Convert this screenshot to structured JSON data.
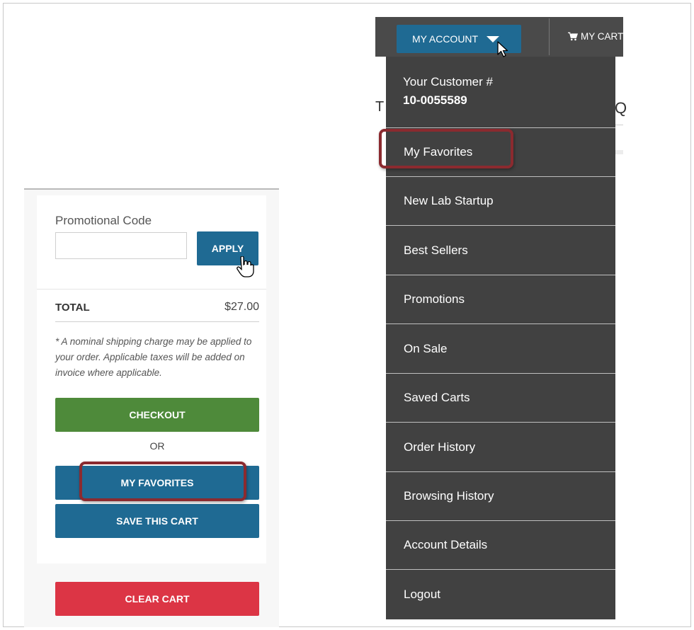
{
  "cart": {
    "promo_label": "Promotional Code",
    "promo_input_value": "",
    "apply_label": "APPLY",
    "total_label": "TOTAL",
    "total_value": "$27.00",
    "shipping_note": "* A nominal shipping charge may be applied to your order. Applicable taxes will be added on invoice where applicable.",
    "checkout_label": "CHECKOUT",
    "or_label": "OR",
    "my_favorites_label": "MY FAVORITES",
    "save_cart_label": "SAVE THIS CART",
    "clear_cart_label": "CLEAR CART"
  },
  "header": {
    "my_account_label": "MY ACCOUNT",
    "my_cart_label": "MY CART",
    "behind_left_letter": "T",
    "behind_right_letter": "Q"
  },
  "dropdown": {
    "customer_line1": "Your Customer #",
    "customer_number": "10-0055589",
    "items": [
      {
        "label": "My Favorites"
      },
      {
        "label": "New Lab Startup"
      },
      {
        "label": "Best Sellers"
      },
      {
        "label": "Promotions"
      },
      {
        "label": "On Sale"
      },
      {
        "label": "Saved Carts"
      },
      {
        "label": "Order History"
      },
      {
        "label": "Browsing History"
      },
      {
        "label": "Account Details"
      },
      {
        "label": "Logout"
      }
    ]
  },
  "colors": {
    "primary_blue": "#1f6a93",
    "checkout_green": "#4e8a3a",
    "clear_red": "#dc3545",
    "dropdown_bg": "#414141",
    "highlight_border": "#8b2a2f"
  }
}
